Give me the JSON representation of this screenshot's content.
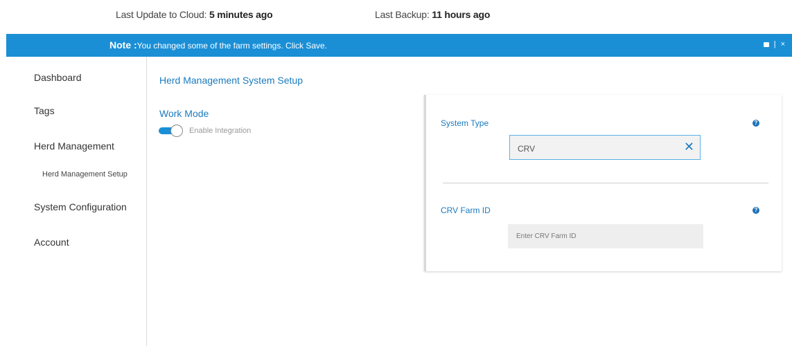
{
  "header": {
    "cloud_label": "Last Update to Cloud:",
    "cloud_value": "5 minutes ago",
    "backup_label": "Last Backup:",
    "backup_value": "11 hours ago"
  },
  "note": {
    "label": "Note :",
    "message": "You changed some of the farm settings. Click Save.",
    "separator": "|",
    "close": "×",
    "color": "#1a8fd6"
  },
  "sidebar": {
    "items": [
      {
        "label": "Dashboard"
      },
      {
        "label": "Tags"
      },
      {
        "label": "Herd Management"
      },
      {
        "label": "Herd Management Setup"
      },
      {
        "label": "System Configuration"
      },
      {
        "label": "Account"
      }
    ]
  },
  "main": {
    "title": "Herd Management System Setup",
    "work_mode": {
      "heading": "Work Mode",
      "toggle_label": "Enable Integration",
      "toggle_on": true
    }
  },
  "panel": {
    "system_type": {
      "label": "System Type",
      "value": "CRV",
      "help_icon": "question-circle-icon",
      "clear_icon": "close-icon"
    },
    "farm_id": {
      "label": "CRV Farm ID",
      "placeholder": "Enter CRV Farm ID",
      "help_icon": "question-circle-icon"
    }
  }
}
